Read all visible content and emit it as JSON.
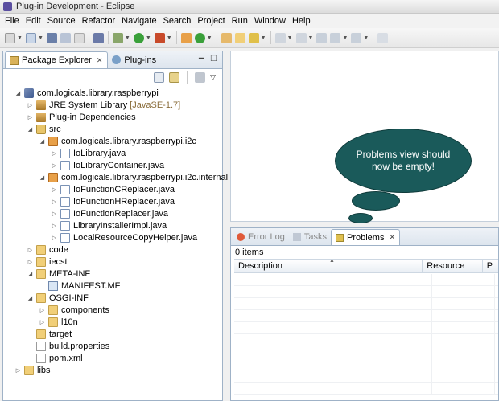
{
  "window": {
    "title": "Plug-in Development - Eclipse",
    "title_extra": "",
    "icon_color": "#5a4ea0"
  },
  "menu": [
    "File",
    "Edit",
    "Source",
    "Refactor",
    "Navigate",
    "Search",
    "Project",
    "Run",
    "Window",
    "Help"
  ],
  "left_pane": {
    "tabs": [
      {
        "label": "Package Explorer",
        "active": true,
        "icon": "package-explorer-icon"
      },
      {
        "label": "Plug-ins",
        "active": false,
        "icon": "plugins-icon"
      }
    ],
    "tree": [
      {
        "label": "com.logicals.library.raspberrypi",
        "depth": 0,
        "expanded": true,
        "icon": "project"
      },
      {
        "label": "JRE System Library",
        "sub": "[JavaSE-1.7]",
        "depth": 1,
        "expanded": false,
        "icon": "lib"
      },
      {
        "label": "Plug-in Dependencies",
        "depth": 1,
        "expanded": false,
        "icon": "lib"
      },
      {
        "label": "src",
        "depth": 1,
        "expanded": true,
        "icon": "srcfolder"
      },
      {
        "label": "com.logicals.library.raspberrypi.i2c",
        "depth": 2,
        "expanded": true,
        "icon": "pkg"
      },
      {
        "label": "IoLibrary.java",
        "depth": 3,
        "expanded": false,
        "icon": "java"
      },
      {
        "label": "IoLibraryContainer.java",
        "depth": 3,
        "expanded": false,
        "icon": "java"
      },
      {
        "label": "com.logicals.library.raspberrypi.i2c.internal",
        "depth": 2,
        "expanded": true,
        "icon": "pkg"
      },
      {
        "label": "IoFunctionCReplacer.java",
        "depth": 3,
        "expanded": false,
        "icon": "java"
      },
      {
        "label": "IoFunctionHReplacer.java",
        "depth": 3,
        "expanded": false,
        "icon": "java"
      },
      {
        "label": "IoFunctionReplacer.java",
        "depth": 3,
        "expanded": false,
        "icon": "java"
      },
      {
        "label": "LibraryInstallerImpl.java",
        "depth": 3,
        "expanded": false,
        "icon": "java"
      },
      {
        "label": "LocalResourceCopyHelper.java",
        "depth": 3,
        "expanded": false,
        "icon": "java"
      },
      {
        "label": "code",
        "depth": 1,
        "expanded": false,
        "icon": "folder"
      },
      {
        "label": "iecst",
        "depth": 1,
        "expanded": false,
        "icon": "folder"
      },
      {
        "label": "META-INF",
        "depth": 1,
        "expanded": true,
        "icon": "folder"
      },
      {
        "label": "MANIFEST.MF",
        "depth": 2,
        "leaf": true,
        "icon": "mf"
      },
      {
        "label": "OSGI-INF",
        "depth": 1,
        "expanded": true,
        "icon": "folder"
      },
      {
        "label": "components",
        "depth": 2,
        "expanded": false,
        "icon": "folder"
      },
      {
        "label": "l10n",
        "depth": 2,
        "expanded": false,
        "icon": "folder"
      },
      {
        "label": "target",
        "depth": 1,
        "leaf": true,
        "icon": "folder"
      },
      {
        "label": "build.properties",
        "depth": 1,
        "leaf": true,
        "icon": "xml"
      },
      {
        "label": "pom.xml",
        "depth": 1,
        "leaf": true,
        "icon": "xml"
      },
      {
        "label": "libs",
        "depth": 0,
        "expanded": false,
        "icon": "folder"
      }
    ]
  },
  "callout": {
    "text": "Problems view should now be empty!",
    "color": "#1a5a5a"
  },
  "bottom_panel": {
    "tabs": [
      {
        "label": "Error Log",
        "active": false
      },
      {
        "label": "Tasks",
        "active": false
      },
      {
        "label": "Problems",
        "active": true
      }
    ],
    "items_count": "0 items",
    "columns": [
      "Description",
      "Resource",
      "P"
    ]
  }
}
